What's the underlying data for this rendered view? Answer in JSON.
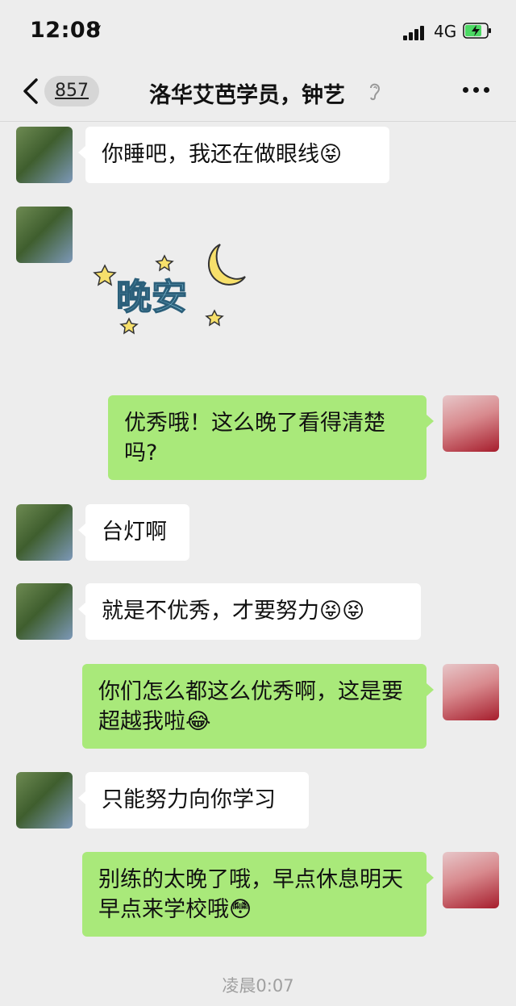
{
  "status_bar": {
    "time": "12:08",
    "network": "4G"
  },
  "nav": {
    "unread_count": "857",
    "title": "洛华艾芭学员，钟艺"
  },
  "messages": [
    {
      "from": "other",
      "text": "你睡吧，我还在做眼线😝"
    },
    {
      "from": "other",
      "sticker": "晚安"
    },
    {
      "from": "self",
      "text": "优秀哦！这么晚了看得清楚吗?"
    },
    {
      "from": "other",
      "text": "台灯啊"
    },
    {
      "from": "other",
      "text": "就是不优秀，才要努力😝😝"
    },
    {
      "from": "self",
      "text": "你们怎么都这么优秀啊，这是要超越我啦😂"
    },
    {
      "from": "other",
      "text": "只能努力向你学习"
    },
    {
      "from": "self",
      "text": "别练的太晚了哦，早点休息明天早点来学校哦😳"
    }
  ],
  "timestamp": "凌晨0:07",
  "colors": {
    "background": "#ededed",
    "self_bubble": "#a9e97a",
    "other_bubble": "#ffffff"
  }
}
